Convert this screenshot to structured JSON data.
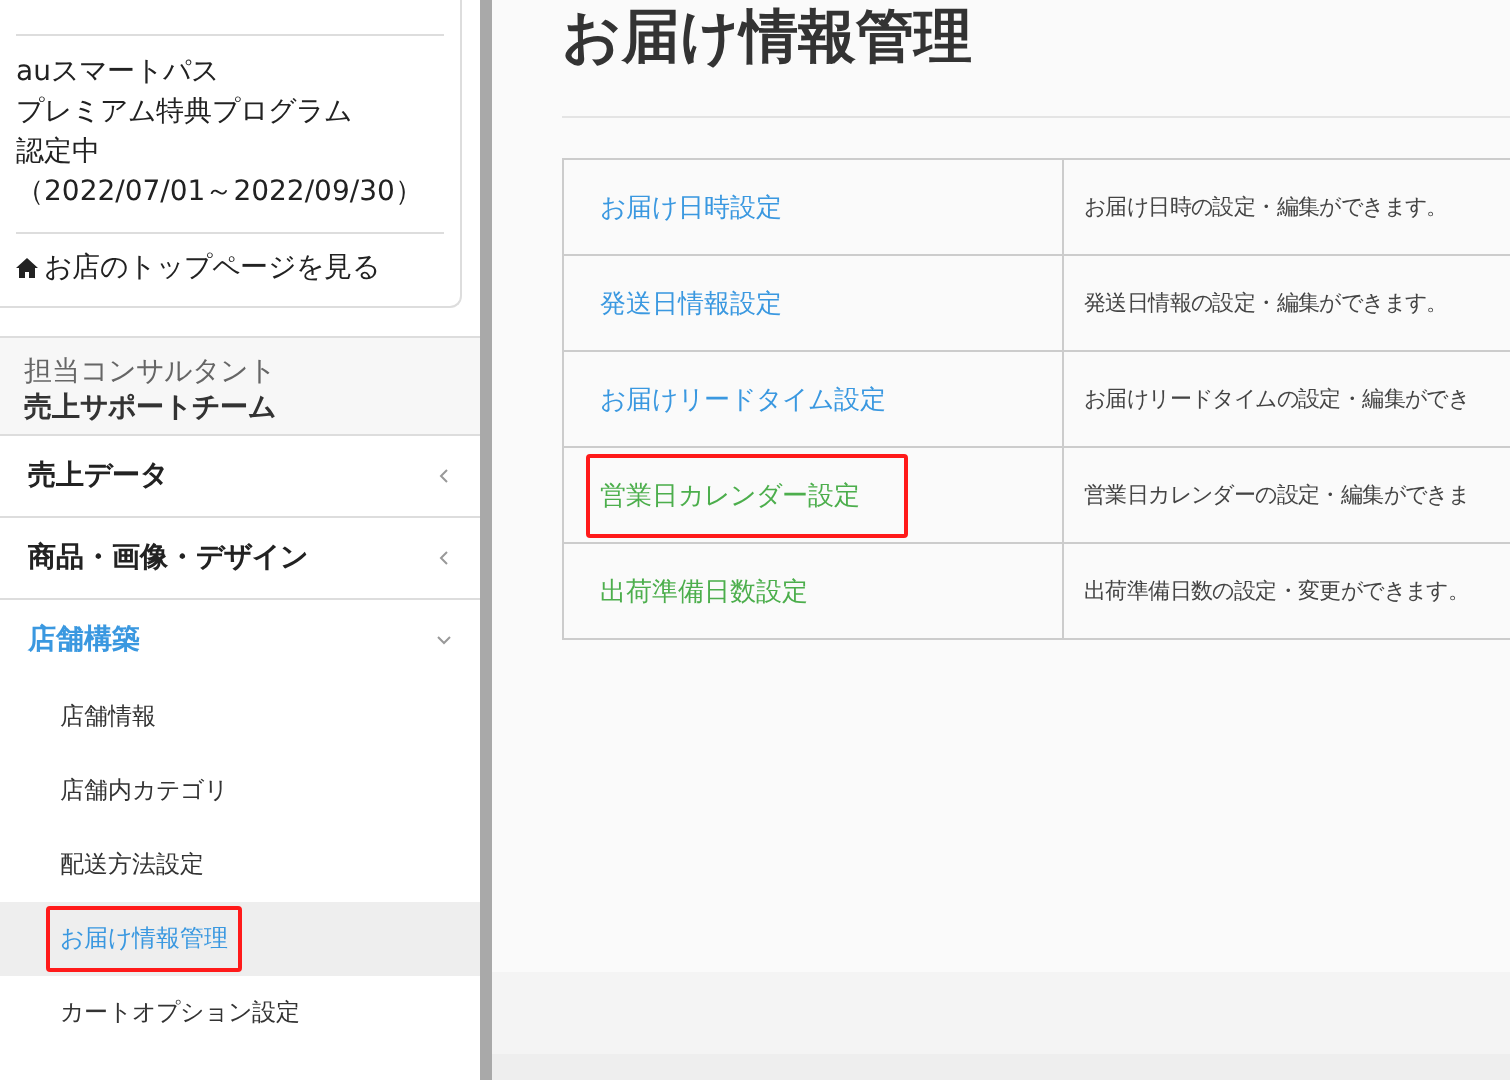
{
  "sidebar": {
    "program": {
      "lines": [
        "auスマートパス",
        "プレミアム特典プログラム",
        "認定中",
        "（2022/07/01～2022/09/30）"
      ]
    },
    "store_link": "お店のトップページを見る",
    "consultant": {
      "label": "担当コンサルタント",
      "name": "売上サポートチーム"
    },
    "menu": [
      {
        "label": "売上データ",
        "expanded": false
      },
      {
        "label": "商品・画像・デザイン",
        "expanded": false
      },
      {
        "label": "店舗構築",
        "expanded": true,
        "children": [
          {
            "label": "店舗情報",
            "selected": false,
            "annotated": false
          },
          {
            "label": "店舗内カテゴリ",
            "selected": false,
            "annotated": false
          },
          {
            "label": "配送方法設定",
            "selected": false,
            "annotated": false
          },
          {
            "label": "お届け情報管理",
            "selected": true,
            "annotated": true
          },
          {
            "label": "カートオプション設定",
            "selected": false,
            "annotated": false
          }
        ]
      }
    ]
  },
  "page": {
    "title": "お届け情報管理",
    "rows": [
      {
        "link": "お届け日時設定",
        "color": "#3a98e0",
        "annotated": false,
        "description": "お届け日時の設定・編集ができます。"
      },
      {
        "link": "発送日情報設定",
        "color": "#3a98e0",
        "annotated": false,
        "description": "発送日情報の設定・編集ができます。"
      },
      {
        "link": "お届けリードタイム設定",
        "color": "#3a98e0",
        "annotated": false,
        "description": "お届けリードタイムの設定・編集ができ"
      },
      {
        "link": "営業日カレンダー設定",
        "color": "#4cae4c",
        "annotated": true,
        "description": "営業日カレンダーの設定・編集ができま"
      },
      {
        "link": "出荷準備日数設定",
        "color": "#4cae4c",
        "annotated": false,
        "description": "出荷準備日数の設定・変更ができます。"
      }
    ]
  }
}
